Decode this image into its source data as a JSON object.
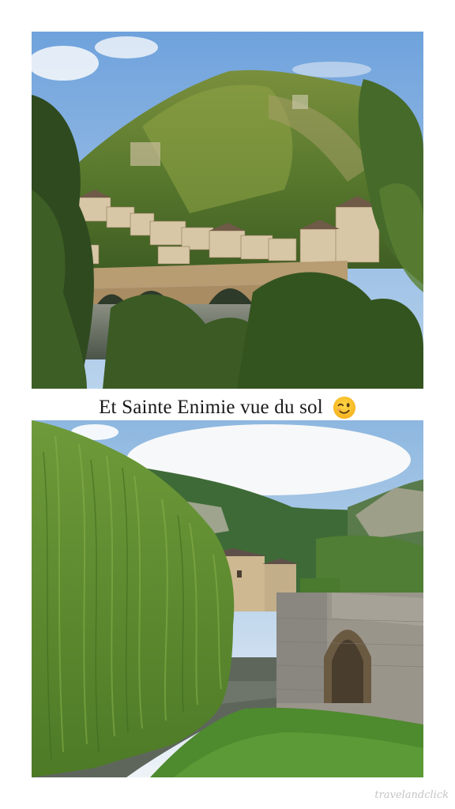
{
  "caption": {
    "text": "Et Sainte Enimie vue du sol",
    "emoji": "winking-face"
  },
  "photos": [
    {
      "name": "village-aerial-view",
      "subject": "Sainte Enimie village with stone bridge"
    },
    {
      "name": "ground-level-view",
      "subject": "Stone bridge and weeping willow"
    }
  ]
}
